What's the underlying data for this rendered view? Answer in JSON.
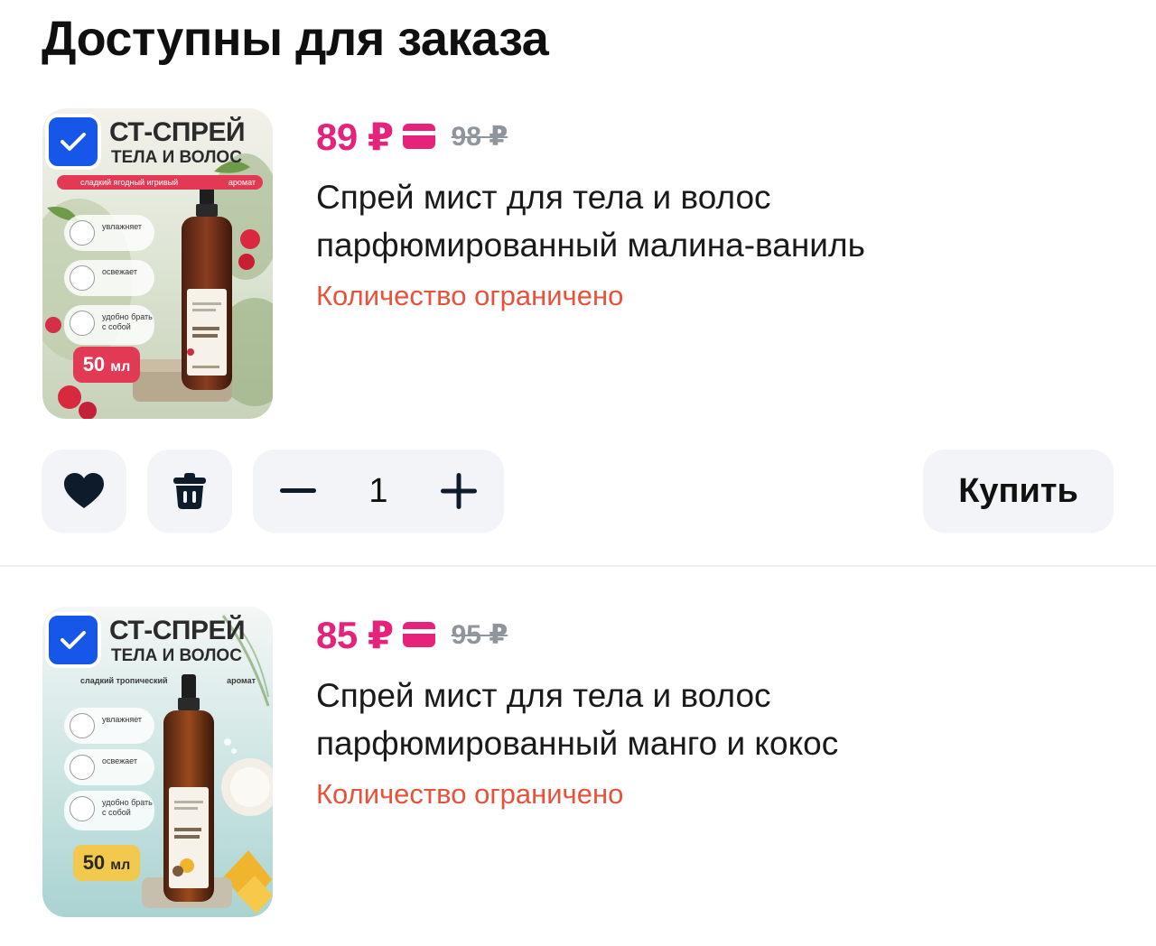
{
  "section": {
    "title": "Доступны для заказа"
  },
  "products": [
    {
      "image": {
        "headline": "СТ-СПРЕЙ",
        "subline": "ТЕЛА И ВОЛОС",
        "tagline_left": "сладкий ягодный игривый",
        "tagline_right": "аромат",
        "benefits": [
          "увлажняет",
          "освежает",
          "удобно брать с собой"
        ],
        "volume_number": "50",
        "volume_unit": "мл",
        "bottle_label": "МАЛИНА И ЗЕЛЕНЬ",
        "brand": "FAMILYSOL",
        "accent": "#e23a55"
      },
      "selected": true,
      "price": "89 ₽",
      "old_price": "98 ₽",
      "title": "Спрей мист для тела и волос парфюмированный малина-ваниль",
      "stock_note": "Количество ограничено",
      "quantity": "1",
      "buy_label": "Купить"
    },
    {
      "image": {
        "headline": "СТ-СПРЕЙ",
        "subline": "ТЕЛА И ВОЛОС",
        "tagline_left": "сладкий тропический",
        "tagline_right": "аромат",
        "benefits": [
          "увлажняет",
          "освежает",
          "удобно брать с собой"
        ],
        "volume_number": "50",
        "volume_unit": "мл",
        "bottle_label": "МАНГО И КОКОС",
        "brand": "FAMILYSOL",
        "accent": "#f2c94c"
      },
      "selected": true,
      "price": "85 ₽",
      "old_price": "95 ₽",
      "title": "Спрей мист для тела и волос парфюмированный манго и кокос",
      "stock_note": "Количество ограничено"
    }
  ],
  "icons": {
    "checkbox": "check-icon",
    "card": "bank-card-icon",
    "favorite": "heart-icon",
    "delete": "trash-icon",
    "decrease": "minus-icon",
    "increase": "plus-icon"
  },
  "colors": {
    "price": "#e6237b",
    "stock_warning": "#e8523a",
    "checkbox": "#1656e8",
    "old_price": "#8f959c",
    "button_bg": "#f2f4f7"
  }
}
